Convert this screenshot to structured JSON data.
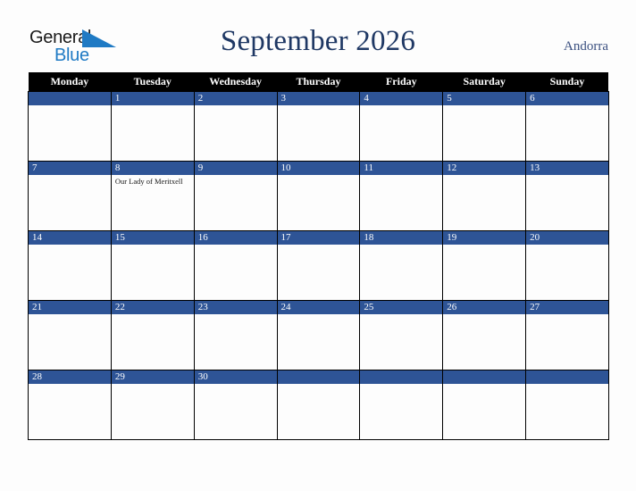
{
  "brand": {
    "name_part1": "General",
    "name_part2": "Blue",
    "triangle_color": "#1f7ac4"
  },
  "header": {
    "title": "September 2026",
    "country": "Andorra"
  },
  "theme": {
    "header_row_bg": "#000000",
    "header_row_text": "#ffffff",
    "daynum_bg": "#2e5496",
    "daynum_text": "#ffffff",
    "cell_bg": "#fdfdfd",
    "title_color": "#1f3864",
    "country_color": "#3b5080",
    "page_bg": "#fdfdfd"
  },
  "calendar": {
    "month": "September",
    "year": "2026",
    "weekday_headers": [
      "Monday",
      "Tuesday",
      "Wednesday",
      "Thursday",
      "Friday",
      "Saturday",
      "Sunday"
    ],
    "weeks": [
      [
        {
          "day": "",
          "events": []
        },
        {
          "day": "1",
          "events": []
        },
        {
          "day": "2",
          "events": []
        },
        {
          "day": "3",
          "events": []
        },
        {
          "day": "4",
          "events": []
        },
        {
          "day": "5",
          "events": []
        },
        {
          "day": "6",
          "events": []
        }
      ],
      [
        {
          "day": "7",
          "events": []
        },
        {
          "day": "8",
          "events": [
            "Our Lady of Meritxell"
          ]
        },
        {
          "day": "9",
          "events": []
        },
        {
          "day": "10",
          "events": []
        },
        {
          "day": "11",
          "events": []
        },
        {
          "day": "12",
          "events": []
        },
        {
          "day": "13",
          "events": []
        }
      ],
      [
        {
          "day": "14",
          "events": []
        },
        {
          "day": "15",
          "events": []
        },
        {
          "day": "16",
          "events": []
        },
        {
          "day": "17",
          "events": []
        },
        {
          "day": "18",
          "events": []
        },
        {
          "day": "19",
          "events": []
        },
        {
          "day": "20",
          "events": []
        }
      ],
      [
        {
          "day": "21",
          "events": []
        },
        {
          "day": "22",
          "events": []
        },
        {
          "day": "23",
          "events": []
        },
        {
          "day": "24",
          "events": []
        },
        {
          "day": "25",
          "events": []
        },
        {
          "day": "26",
          "events": []
        },
        {
          "day": "27",
          "events": []
        }
      ],
      [
        {
          "day": "28",
          "events": []
        },
        {
          "day": "29",
          "events": []
        },
        {
          "day": "30",
          "events": []
        },
        {
          "day": "",
          "events": []
        },
        {
          "day": "",
          "events": []
        },
        {
          "day": "",
          "events": []
        },
        {
          "day": "",
          "events": []
        }
      ]
    ]
  }
}
